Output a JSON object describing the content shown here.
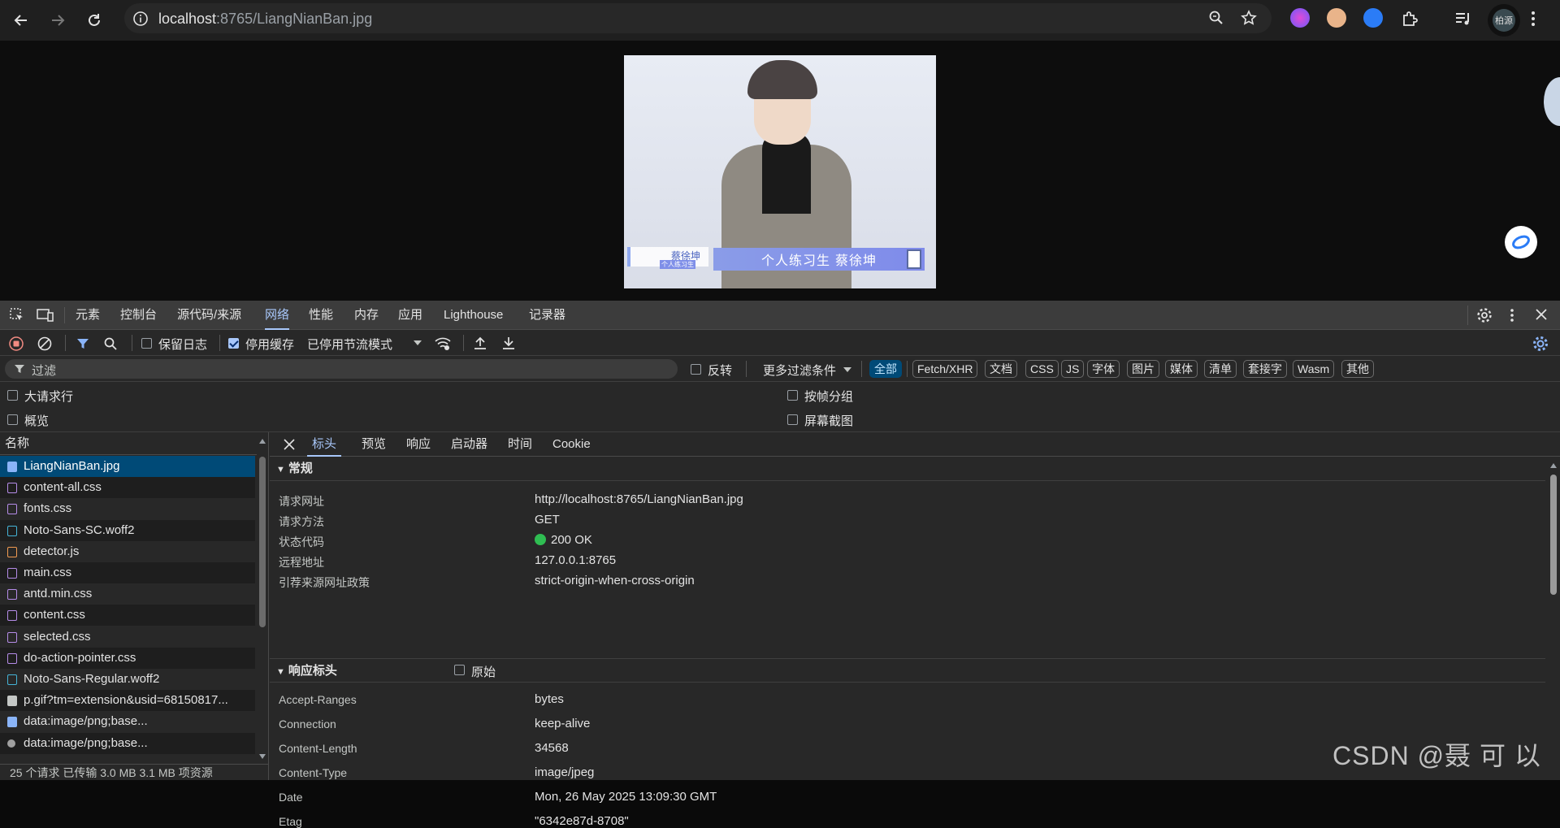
{
  "browser": {
    "url_host": "localhost",
    "url_rest": ":8765/LiangNianBan.jpg",
    "profile_label": "柏源"
  },
  "photo": {
    "name_small": "蔡徐坤",
    "tag_small": "个人练习生",
    "banner_text": "个人练习生  蔡徐坤"
  },
  "devtools": {
    "tabs": [
      "元素",
      "控制台",
      "源代码/来源",
      "网络",
      "性能",
      "内存",
      "应用",
      "Lighthouse",
      "记录器"
    ],
    "active_tab": "网络",
    "toolbar": {
      "preserve_log": "保留日志",
      "disable_cache": "停用缓存",
      "throttling": "已停用节流模式"
    },
    "filter": {
      "placeholder": "过滤",
      "invert": "反转",
      "more_filters": "更多过滤条件",
      "chips": [
        "全部",
        "Fetch/XHR",
        "文档",
        "CSS",
        "JS",
        "字体",
        "图片",
        "媒体",
        "清单",
        "套接字",
        "Wasm",
        "其他"
      ]
    },
    "options": {
      "big_rows": "大请求行",
      "overview": "概览",
      "group_by_frame": "按帧分组",
      "screenshots": "屏幕截图"
    },
    "request_list": {
      "header": "名称",
      "rows": [
        {
          "name": "LiangNianBan.jpg",
          "type": "img"
        },
        {
          "name": "content-all.css",
          "type": "css"
        },
        {
          "name": "fonts.css",
          "type": "css"
        },
        {
          "name": "Noto-Sans-SC.woff2",
          "type": "font"
        },
        {
          "name": "detector.js",
          "type": "js"
        },
        {
          "name": "main.css",
          "type": "css"
        },
        {
          "name": "antd.min.css",
          "type": "css"
        },
        {
          "name": "content.css",
          "type": "css"
        },
        {
          "name": "selected.css",
          "type": "css"
        },
        {
          "name": "do-action-pointer.css",
          "type": "css"
        },
        {
          "name": "Noto-Sans-Regular.woff2",
          "type": "font"
        },
        {
          "name": "p.gif?tm=extension&usid=68150817...",
          "type": "doc"
        },
        {
          "name": "data:image/png;base...",
          "type": "img"
        },
        {
          "name": "data:image/png;base...",
          "type": "dot"
        }
      ],
      "footer": "25 个请求  已传输 3.0 MB  3.1 MB 项资源"
    },
    "details": {
      "tabs": [
        "标头",
        "预览",
        "响应",
        "启动器",
        "时间",
        "Cookie"
      ],
      "active_tab": "标头",
      "general_title": "常规",
      "general": [
        {
          "key": "请求网址",
          "value": "http://localhost:8765/LiangNianBan.jpg"
        },
        {
          "key": "请求方法",
          "value": "GET"
        },
        {
          "key": "状态代码",
          "value": "200 OK"
        },
        {
          "key": "远程地址",
          "value": "127.0.0.1:8765"
        },
        {
          "key": "引荐来源网址政策",
          "value": "strict-origin-when-cross-origin"
        }
      ],
      "response_title": "响应标头",
      "raw_label": "原始",
      "response": [
        {
          "key": "Accept-Ranges",
          "value": "bytes"
        },
        {
          "key": "Connection",
          "value": "keep-alive"
        },
        {
          "key": "Content-Length",
          "value": "34568"
        },
        {
          "key": "Content-Type",
          "value": "image/jpeg"
        },
        {
          "key": "Date",
          "value": "Mon, 26 May 2025 13:09:30 GMT"
        },
        {
          "key": "Etag",
          "value": "\"6342e87d-8708\""
        }
      ]
    }
  },
  "watermark": "CSDN @聂 可 以"
}
